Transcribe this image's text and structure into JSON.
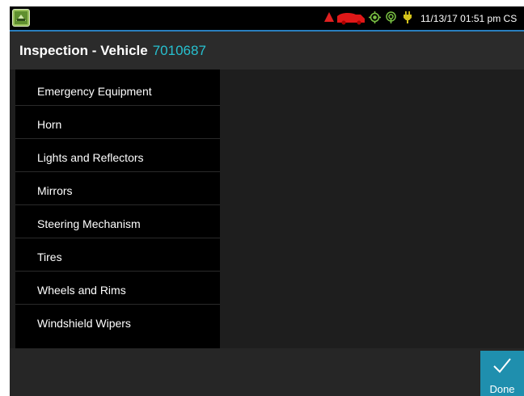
{
  "status_bar": {
    "icons": [
      "app-icon",
      "warning-triangle-icon",
      "truck-icon",
      "gps-icon",
      "signal-icon",
      "power-plug-icon"
    ],
    "datetime": "11/13/17 01:51 pm CS"
  },
  "header": {
    "title": "Inspection - Vehicle",
    "vehicle_id": "7010687"
  },
  "checklist": {
    "items": [
      {
        "label": "Emergency Equipment"
      },
      {
        "label": "Horn"
      },
      {
        "label": "Lights and Reflectors"
      },
      {
        "label": "Mirrors"
      },
      {
        "label": "Steering Mechanism"
      },
      {
        "label": "Tires"
      },
      {
        "label": "Wheels and Rims"
      },
      {
        "label": "Windshield Wipers"
      }
    ]
  },
  "footer": {
    "done_label": "Done"
  },
  "colors": {
    "accent": "#27c0cf",
    "done_button": "#1f8fae",
    "status_warning": "#e02020",
    "status_ok": "#7ac143"
  }
}
